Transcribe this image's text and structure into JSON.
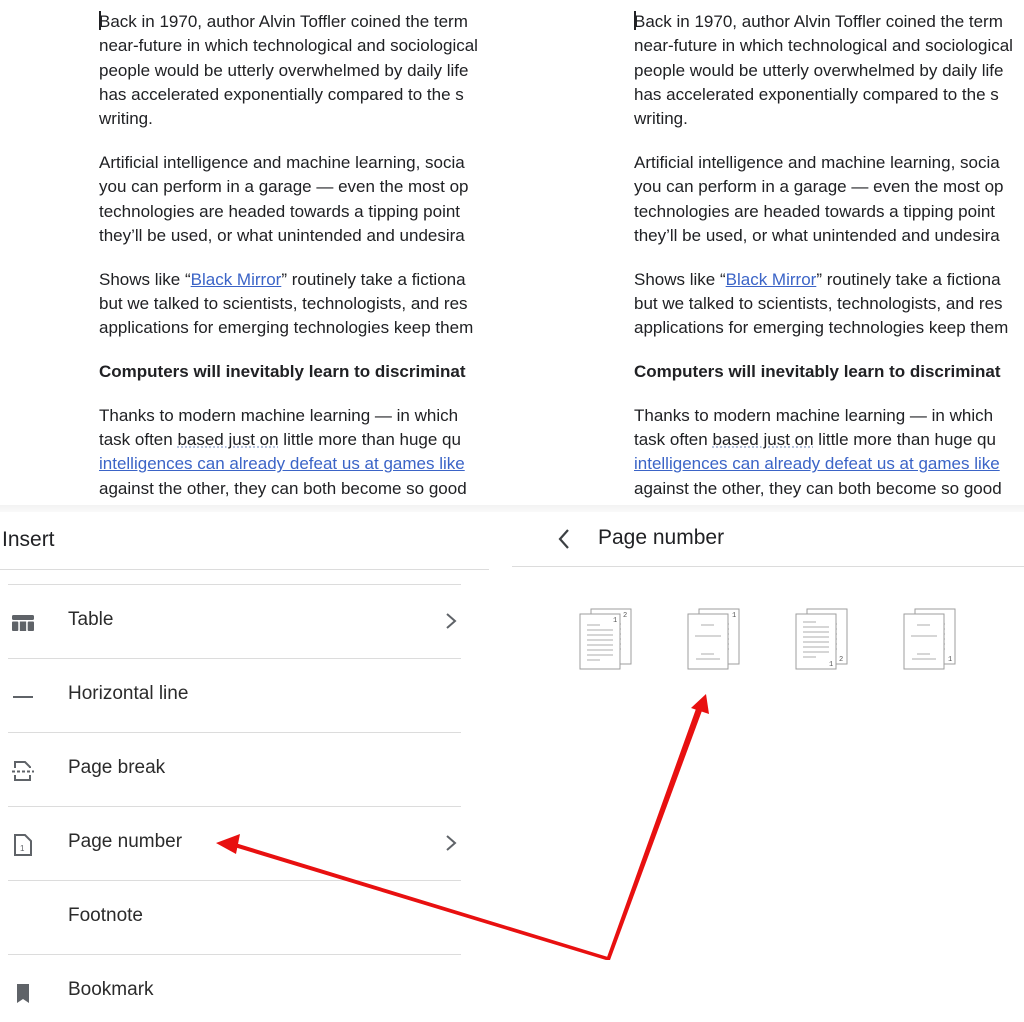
{
  "document": {
    "paragraphs": [
      {
        "lines": [
          "Back in 1970, author Alvin Toffler coined the term",
          "near-future in which technological and sociological",
          "people would be utterly overwhelmed by daily life",
          "has accelerated exponentially compared to the s",
          "writing."
        ]
      },
      {
        "lines": [
          "Artificial intelligence and machine learning, socia",
          "you can perform in a garage — even the most op",
          "technologies are headed towards a tipping point",
          "they’ll be used, or what unintended and undesira"
        ]
      },
      {
        "prefix": "Shows like “",
        "link": "Black Mirror",
        "suffix": "” routinely take a fictiona",
        "lines": [
          "but we talked to scientists, technologists, and res",
          "applications for emerging technologies keep them"
        ]
      },
      {
        "heading": "Computers will inevitably learn to discriminat"
      },
      {
        "line1": "Thanks to modern machine learning — in which",
        "line2_prefix": "task often ",
        "line2_dotted": "based just on",
        "line2_suffix": " little more than huge qu",
        "link_line": "intelligences can already defeat us at games like",
        "line4": "against the other, they can both become so good"
      }
    ]
  },
  "insert_menu": {
    "title": "Insert",
    "items": [
      {
        "label": "Table",
        "icon": "table-icon",
        "has_submenu": true
      },
      {
        "label": "Horizontal line",
        "icon": "horizontal-line-icon",
        "has_submenu": false
      },
      {
        "label": "Page break",
        "icon": "page-break-icon",
        "has_submenu": false
      },
      {
        "label": "Page number",
        "icon": "page-number-icon",
        "has_submenu": true
      },
      {
        "label": "Footnote",
        "icon": "",
        "has_submenu": false
      },
      {
        "label": "Bookmark",
        "icon": "bookmark-icon",
        "has_submenu": false
      }
    ]
  },
  "page_number_menu": {
    "title": "Page number",
    "back_icon": "chevron-left-icon",
    "options": [
      {
        "name": "top-right-all-pages",
        "numbers": [
          "1",
          "2"
        ]
      },
      {
        "name": "top-right-skip-first",
        "numbers": [
          "1"
        ]
      },
      {
        "name": "bottom-right-all-pages",
        "numbers": [
          "1",
          "2"
        ]
      },
      {
        "name": "bottom-right-skip-first",
        "numbers": [
          "1"
        ]
      }
    ]
  },
  "annotation": {
    "color": "#e81010"
  }
}
